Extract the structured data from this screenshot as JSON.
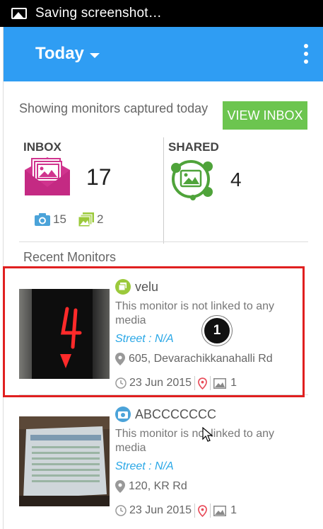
{
  "status_bar": {
    "text": "Saving screenshot…",
    "icon": "image-icon"
  },
  "app_bar": {
    "title": "Today",
    "menu_icon": "more-vert-icon",
    "color": "#2f9df3"
  },
  "summary": {
    "showing_text": "Showing monitors captured today",
    "view_inbox_label": "VIEW INBOX",
    "inbox": {
      "label": "INBOX",
      "count": "17",
      "photo_count": "15",
      "media_count": "2"
    },
    "shared": {
      "label": "SHARED",
      "count": "4"
    }
  },
  "recent_label": "Recent Monitors",
  "monitors": [
    {
      "name": "velu",
      "type_icon": "media-icon",
      "message": "This monitor is not linked to any media",
      "street": "Street : N/A",
      "address": "605, Devarachikkanahalli Rd",
      "date": "23 Jun 2015",
      "image_count": "1",
      "thumbnail": "elevator-display-4"
    },
    {
      "name": "ABCCCCCCC",
      "type_icon": "camera-icon",
      "message": "This monitor is not linked to any media",
      "street": "Street : N/A",
      "address": "120, KR Rd",
      "date": "23 Jun 2015",
      "image_count": "1",
      "thumbnail": "laptop-screen"
    }
  ],
  "annotation": {
    "step": "1",
    "color": "#e02020"
  },
  "colors": {
    "accent_green": "#6cc54f",
    "street_blue": "#2aa7e6",
    "inbox_pink": "#d0348e"
  }
}
